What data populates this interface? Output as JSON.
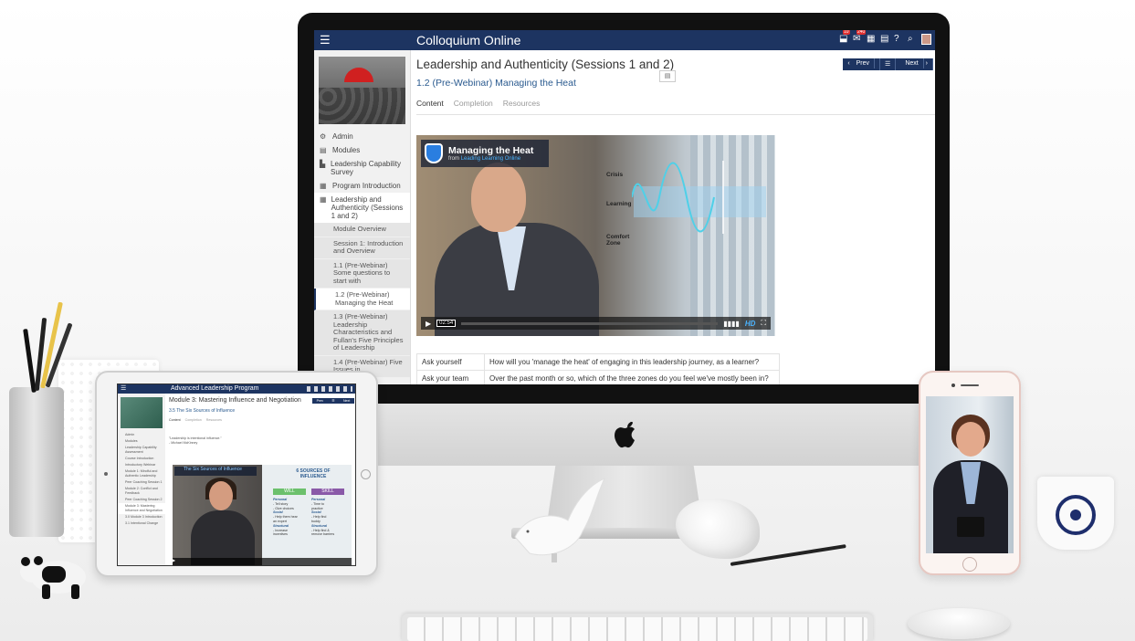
{
  "app": {
    "title": "Colloquium Online",
    "badges": {
      "notifications": "10",
      "messages": "240"
    }
  },
  "lesson": {
    "title": "Leadership and Authenticity (Sessions 1 and 2)",
    "subtitle": "1.2 (Pre-Webinar) Managing the Heat",
    "pager": {
      "prev": "Prev",
      "next": "Next"
    },
    "tabs": [
      "Content",
      "Completion",
      "Resources"
    ]
  },
  "sidebar": {
    "items": [
      {
        "icon": "gear-icon",
        "glyph": "⚙",
        "label": "Admin"
      },
      {
        "icon": "list-icon",
        "glyph": "▤",
        "label": "Modules"
      },
      {
        "icon": "chart-icon",
        "glyph": "▙",
        "label": "Leadership Capability Survey"
      },
      {
        "icon": "film-icon",
        "glyph": "▦",
        "label": "Program Introduction"
      },
      {
        "icon": "film-icon",
        "glyph": "▦",
        "label": "Leadership and Authenticity (Sessions 1 and 2)"
      }
    ],
    "subitems": [
      "Module Overview",
      "Session 1: Introduction and Overview",
      "1.1 (Pre-Webinar) Some questions to start with",
      "1.2 (Pre-Webinar) Managing the Heat",
      "1.3 (Pre-Webinar) Leadership Characteristics and Fullan's Five Principles of Leadership",
      "1.4 (Pre-Webinar) Five Issues in"
    ]
  },
  "video": {
    "title": "Managing the Heat",
    "from_prefix": "from",
    "from_source": "Leading Learning Online",
    "zones": [
      "Crisis",
      "Learning",
      "Comfort Zone"
    ],
    "time": "02:54",
    "hd": "HD"
  },
  "questions": [
    {
      "label": "Ask yourself",
      "text": "How will you 'manage the heat' of engaging in this leadership journey, as a learner?"
    },
    {
      "label": "Ask your team",
      "text": "Over the past month or so, which of the three zones do you feel we've mostly been in?"
    }
  ],
  "tablet": {
    "app_title": "Advanced Leadership Program",
    "title": "Module 3: Mastering Influence and Negotiation",
    "subtitle": "3.5 The Six Sources of Influence",
    "tabs": [
      "Content",
      "Completion",
      "Resources"
    ],
    "pager": [
      "Prev",
      "Next"
    ],
    "quote": "\"Leadership is intentional influence.\"",
    "quote_author": "- Michael McKinney",
    "video_title": "The Six Sources of Influence",
    "six_heading": "6 SOURCES OF INFLUENCE",
    "will": "WILL",
    "skill": "SKILL",
    "nav": [
      "Admin",
      "Modules",
      "Leadership Capability Assessment",
      "Course Introduction",
      "Introductory Webinar",
      "Module 1: Mindful and Authentic Leadership",
      "Peer Coaching Session 1",
      "Module 2: Conflict and Feedback",
      "Peer Coaching Session 2",
      "Module 3: Mastering Influence and Negotiation",
      "3.0 Module 3 Introduction",
      "3.1 Intentional Change"
    ],
    "will_col": [
      "Personal",
      "- Tell story",
      "- Give choices",
      "Social",
      "- Help them hear",
      "  an expert",
      "Structural",
      "- Increase",
      "  incentives"
    ],
    "skill_col": [
      "Personal",
      "- Time to",
      "  practice",
      "Social",
      "- Help find",
      "  buddy",
      "Structural",
      "- Help find &",
      "  remove barriers"
    ]
  },
  "colors": {
    "brand_navy": "#1d3461",
    "link_blue": "#2a5a8f",
    "will_green": "#6cc06c",
    "skill_purple": "#8a59a8"
  }
}
